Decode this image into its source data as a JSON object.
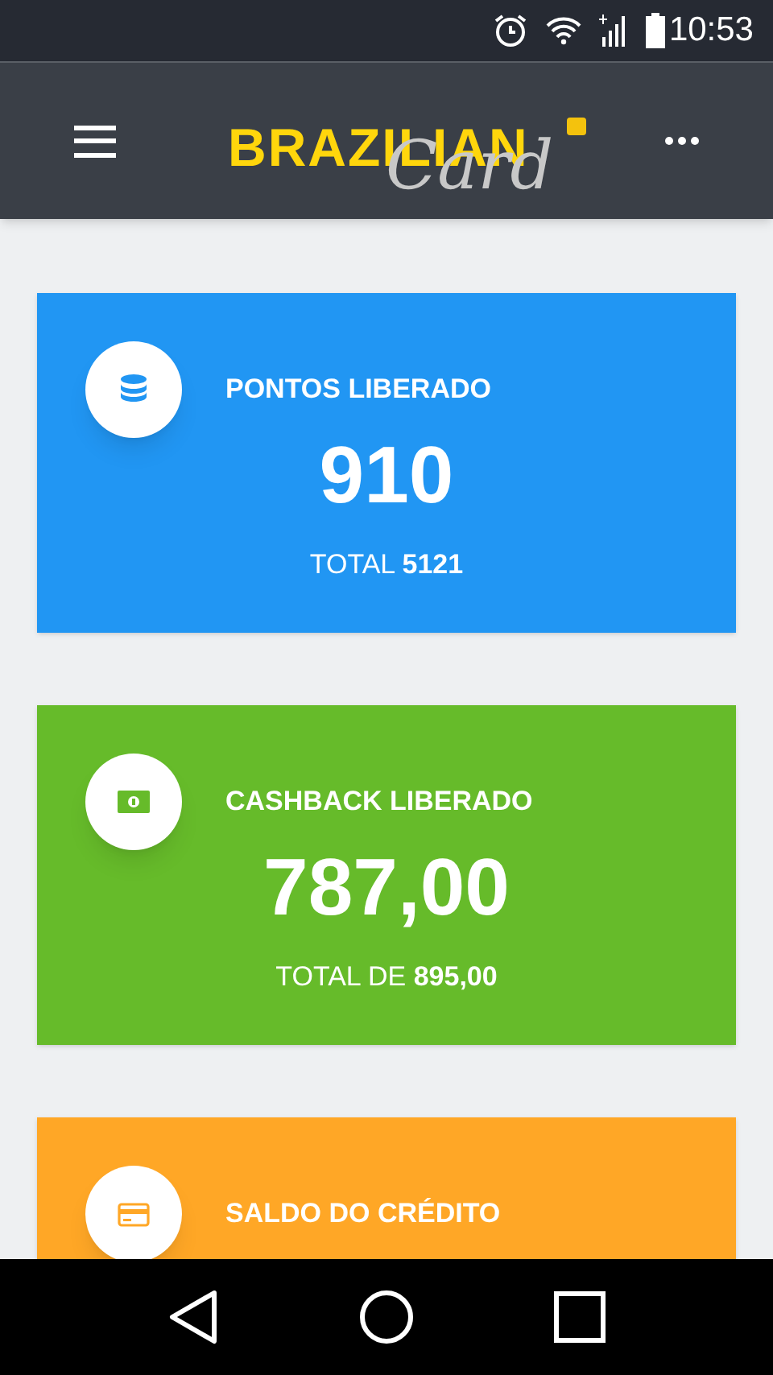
{
  "status_bar": {
    "time": "10:53"
  },
  "app_bar": {
    "logo": {
      "main": "BRAZILIAN",
      "script": "Card"
    }
  },
  "cards": [
    {
      "kind": "points",
      "color": "#2196f3",
      "title": "PONTOS LIBERADO",
      "value": "910",
      "total": "TOTAL **5121**"
    },
    {
      "kind": "cashback",
      "color": "#66bb2a",
      "title": "CASHBACK LIBERADO",
      "value": "787,00",
      "total": "TOTAL DE **895,00**"
    },
    {
      "kind": "credit",
      "color": "#ffa726",
      "title": "SALDO DO CRÉDITO"
    }
  ]
}
